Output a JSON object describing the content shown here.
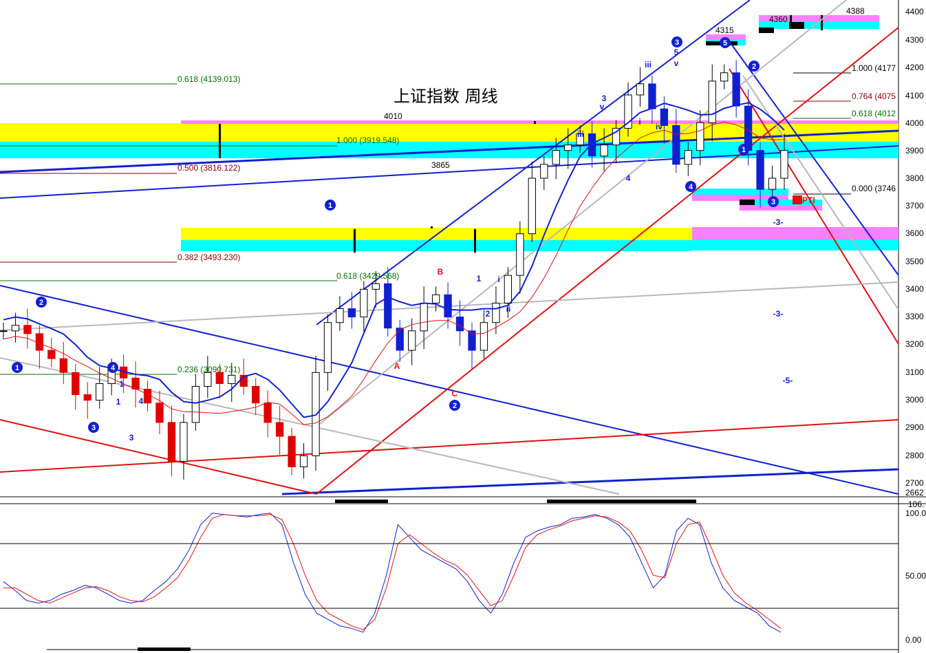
{
  "title": "上证指数 周线",
  "colors": {
    "up": "#000000",
    "down": "#e00000",
    "blue": "#1020d0",
    "red": "#e01010",
    "grey": "#b8b8b8",
    "yellow": "#ffff00",
    "cyan": "#00ffff",
    "magenta": "#ff80ff",
    "fib_green": "#007000",
    "fib_maroon": "#800000",
    "fib_black": "#000000"
  },
  "chart_data": [
    {
      "type": "line",
      "title": "上证指数 周线",
      "ylim": [
        2662,
        4410
      ],
      "y_ticks": [
        "4400",
        "4300",
        "4200",
        "4100",
        "4000",
        "3900",
        "3800",
        "3700",
        "3600",
        "3500",
        "3400",
        "3300",
        "3200",
        "3100",
        "3000",
        "2900",
        "2800",
        "2700",
        "2662"
      ],
      "price_markers": [
        "4388",
        "4360",
        "4315",
        "4010",
        "3865"
      ],
      "fib_levels": [
        {
          "label": "0.618 (4139.013)",
          "value": 4139.013,
          "color": "fib_green"
        },
        {
          "label": "1.000 (3919.548)",
          "value": 3919.548,
          "color": "fib_green"
        },
        {
          "label": "0.500 (3816.122)",
          "value": 3816.122,
          "color": "fib_maroon"
        },
        {
          "label": "0.382 (3493.230)",
          "value": 3493.23,
          "color": "fib_maroon"
        },
        {
          "label": "0.618 (3429.568)",
          "value": 3429.568,
          "color": "fib_green"
        },
        {
          "label": "0.236 (3090.731)",
          "value": 3090.731,
          "color": "fib_green"
        },
        {
          "label": "1.000 (4177",
          "value": 4177,
          "color": "fib_black"
        },
        {
          "label": "0.764 (4075",
          "value": 4075,
          "color": "fib_maroon"
        },
        {
          "label": "0.618 (4012",
          "value": 4012,
          "color": "fib_green"
        },
        {
          "label": "0.000 (3746",
          "value": 3746,
          "color": "fib_black"
        }
      ],
      "wave_labels": [
        "1",
        "2",
        "3",
        "4",
        "5",
        "i",
        "ii",
        "iii",
        "iv",
        "v",
        "A",
        "B",
        "C",
        "-3-",
        "-5-",
        "PTI"
      ],
      "close_points": [
        [
          0,
          3250
        ],
        [
          4,
          3270
        ],
        [
          8,
          3240
        ],
        [
          12,
          3180
        ],
        [
          16,
          3150
        ],
        [
          20,
          3100
        ],
        [
          24,
          3020
        ],
        [
          28,
          3000
        ],
        [
          32,
          3060
        ],
        [
          36,
          3120
        ],
        [
          40,
          3080
        ],
        [
          44,
          3040
        ],
        [
          48,
          2990
        ],
        [
          52,
          2920
        ],
        [
          56,
          2780
        ],
        [
          60,
          2920
        ],
        [
          64,
          3050
        ],
        [
          68,
          3100
        ],
        [
          72,
          3060
        ],
        [
          76,
          3090
        ],
        [
          80,
          3050
        ],
        [
          84,
          2990
        ],
        [
          88,
          2920
        ],
        [
          92,
          2870
        ],
        [
          96,
          2760
        ],
        [
          100,
          2800
        ],
        [
          104,
          3100
        ],
        [
          108,
          3280
        ],
        [
          112,
          3330
        ],
        [
          116,
          3300
        ],
        [
          120,
          3400
        ],
        [
          124,
          3420
        ],
        [
          128,
          3260
        ],
        [
          132,
          3180
        ],
        [
          136,
          3250
        ],
        [
          140,
          3350
        ],
        [
          144,
          3380
        ],
        [
          148,
          3300
        ],
        [
          152,
          3250
        ],
        [
          156,
          3180
        ],
        [
          160,
          3280
        ],
        [
          164,
          3350
        ],
        [
          168,
          3450
        ],
        [
          172,
          3600
        ],
        [
          176,
          3800
        ],
        [
          180,
          3850
        ],
        [
          184,
          3900
        ],
        [
          188,
          3920
        ],
        [
          192,
          3960
        ],
        [
          196,
          3880
        ],
        [
          200,
          3920
        ],
        [
          204,
          3980
        ],
        [
          208,
          4100
        ],
        [
          212,
          4140
        ],
        [
          216,
          4050
        ],
        [
          220,
          3990
        ],
        [
          224,
          3850
        ],
        [
          228,
          3900
        ],
        [
          232,
          4000
        ],
        [
          236,
          4150
        ],
        [
          240,
          4180
        ],
        [
          244,
          4060
        ],
        [
          248,
          3900
        ],
        [
          252,
          3760
        ],
        [
          256,
          3800
        ],
        [
          260,
          3900
        ]
      ]
    },
    {
      "type": "line",
      "title": "",
      "ylim": [
        0,
        106
      ],
      "y_ticks": [
        "106.",
        "100.0",
        "50.00",
        "0.00"
      ],
      "series": [
        {
          "values": [
            45,
            38,
            30,
            28,
            30,
            35,
            38,
            42,
            40,
            35,
            30,
            28,
            30,
            38,
            45,
            55,
            70,
            90,
            99,
            98,
            97,
            96,
            98,
            99,
            90,
            60,
            35,
            20,
            15,
            10,
            8,
            5,
            20,
            50,
            90,
            80,
            70,
            65,
            60,
            55,
            45,
            30,
            20,
            35,
            60,
            80,
            85,
            88,
            90,
            95,
            96,
            98,
            95,
            90,
            80,
            60,
            40,
            50,
            85,
            95,
            90,
            60,
            40,
            30,
            25,
            20,
            10,
            5
          ]
        },
        {
          "values": [
            40,
            40,
            35,
            30,
            28,
            32,
            36,
            40,
            41,
            38,
            33,
            30,
            29,
            33,
            40,
            48,
            62,
            80,
            95,
            98,
            97,
            97,
            97,
            98,
            94,
            75,
            50,
            30,
            20,
            15,
            10,
            7,
            15,
            40,
            75,
            82,
            75,
            68,
            62,
            58,
            50,
            38,
            26,
            30,
            50,
            72,
            82,
            86,
            89,
            93,
            95,
            97,
            96,
            92,
            85,
            70,
            50,
            48,
            75,
            90,
            92,
            72,
            50,
            36,
            28,
            22,
            15,
            8
          ]
        }
      ]
    }
  ]
}
